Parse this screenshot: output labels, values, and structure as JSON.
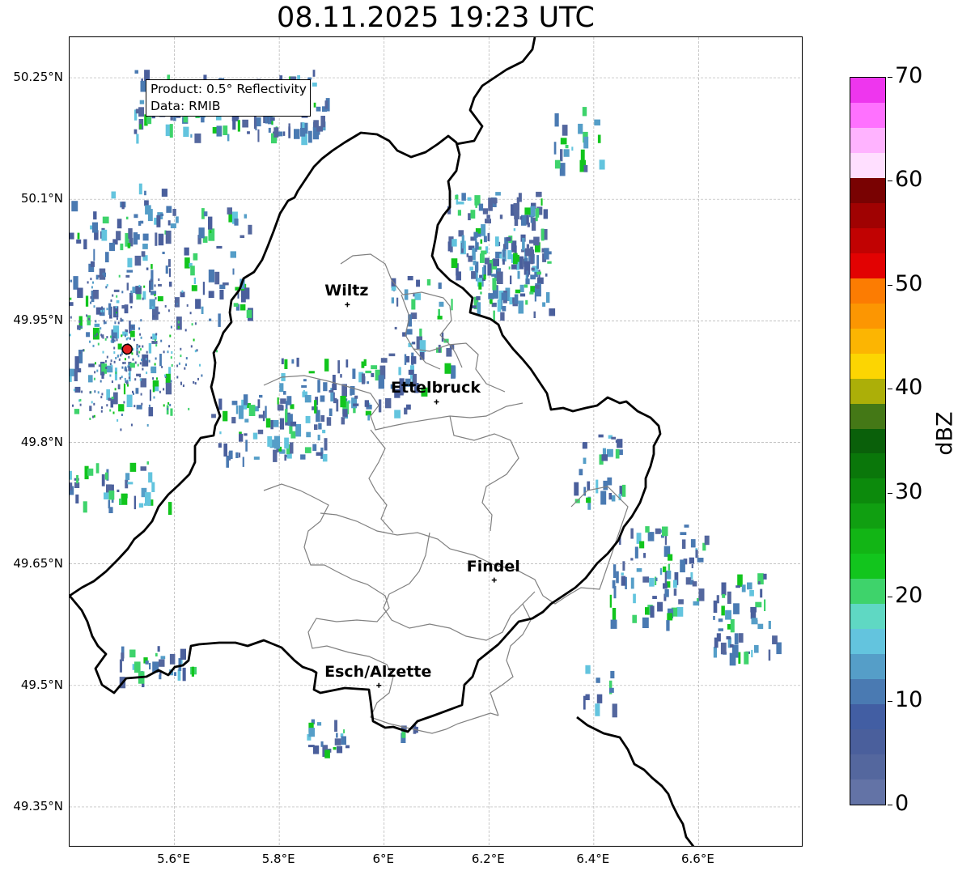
{
  "title": "08.11.2025 19:23 UTC",
  "info_box": {
    "product": "Product: 0.5° Reflectivity",
    "source": "Data: RMIB"
  },
  "axes": {
    "lat_ticks": [
      {
        "value": 50.25,
        "label": "50.25°N"
      },
      {
        "value": 50.1,
        "label": "50.1°N"
      },
      {
        "value": 49.95,
        "label": "49.95°N"
      },
      {
        "value": 49.8,
        "label": "49.8°N"
      },
      {
        "value": 49.65,
        "label": "49.65°N"
      },
      {
        "value": 49.5,
        "label": "49.5°N"
      },
      {
        "value": 49.35,
        "label": "49.35°N"
      }
    ],
    "lon_ticks": [
      {
        "value": 5.6,
        "label": "5.6°E"
      },
      {
        "value": 5.8,
        "label": "5.8°E"
      },
      {
        "value": 6.0,
        "label": "6°E"
      },
      {
        "value": 6.2,
        "label": "6.2°E"
      },
      {
        "value": 6.4,
        "label": "6.4°E"
      },
      {
        "value": 6.6,
        "label": "6.6°E"
      }
    ],
    "lon_range": [
      5.4,
      6.8
    ],
    "lat_range": [
      49.3,
      50.3
    ],
    "grid": true
  },
  "cities": [
    {
      "name": "Wiltz",
      "lon": 5.93,
      "lat": 49.97
    },
    {
      "name": "Ettelbruck",
      "lon": 6.1,
      "lat": 49.85
    },
    {
      "name": "Findel",
      "lon": 6.21,
      "lat": 49.63
    },
    {
      "name": "Esch/Alzette",
      "lon": 5.99,
      "lat": 49.5
    }
  ],
  "radar_site": {
    "lon": 5.51,
    "lat": 49.915
  },
  "colorbar": {
    "label": "dBZ",
    "range": [
      0,
      70
    ],
    "ticks": [
      "0",
      "10",
      "20",
      "30",
      "40",
      "50",
      "60",
      "70"
    ],
    "colors": [
      "#6373a6",
      "#54679e",
      "#4a5f9c",
      "#425ea3",
      "#4a7ab2",
      "#559ec8",
      "#63c4de",
      "#5fd8c3",
      "#3ed36b",
      "#12c51d",
      "#12b515",
      "#109f11",
      "#0c8a0c",
      "#0a770a",
      "#0a600a",
      "#447816",
      "#acaf08",
      "#fcd502",
      "#fcb502",
      "#fc9602",
      "#fc7c02",
      "#e20202",
      "#c10202",
      "#a00202",
      "#790202",
      "#ffdfff",
      "#ffb3ff",
      "#ff71ff",
      "#ee36ee"
    ]
  }
}
